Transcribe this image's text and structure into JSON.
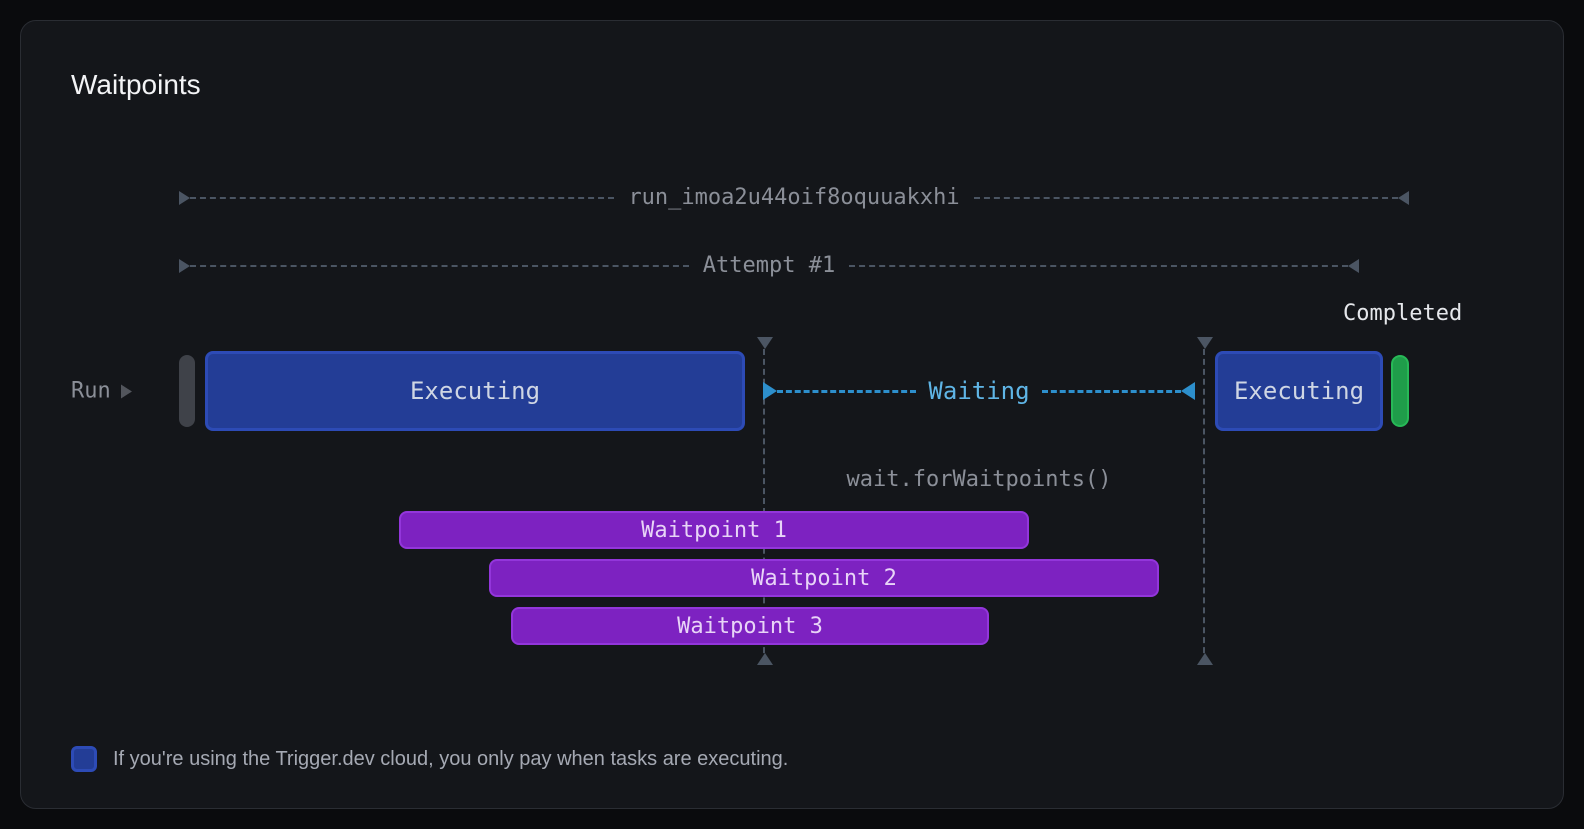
{
  "title": "Waitpoints",
  "run_id": "run_imoa2u44oif8oquuakxhi",
  "attempt_label": "Attempt #1",
  "row_label": "Run",
  "executing_label": "Executing",
  "waiting_label": "Waiting",
  "completed_label": "Completed",
  "wait_call_label": "wait.forWaitpoints()",
  "waitpoints": [
    {
      "label": "Waitpoint 1"
    },
    {
      "label": "Waitpoint 2"
    },
    {
      "label": "Waitpoint 3"
    }
  ],
  "note": "If you're using the Trigger.dev cloud, you only pay when tasks are executing.",
  "colors": {
    "executing": "#233d96",
    "waitpoint": "#7d22c1",
    "completed": "#1f9d4a",
    "waiting": "#2d8fcc"
  }
}
